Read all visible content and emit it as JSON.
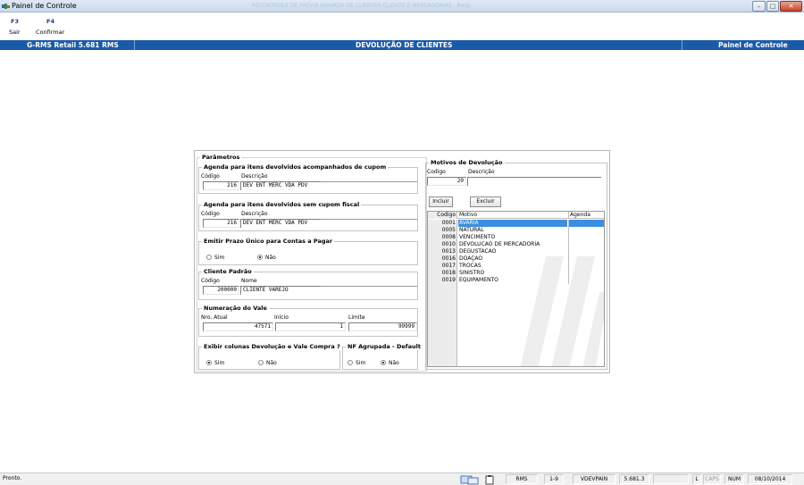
{
  "window": {
    "title": "Painel de Controle",
    "faded_title": "RECONTROLE DE PRÉVIA ENVIADA DE CLIENTES CLIENTE E MERCADORIAS - Rede",
    "controls": {
      "minimize": "–",
      "maximize": "□",
      "close": "✕"
    }
  },
  "toolbar": {
    "items": [
      {
        "key": "F3",
        "label": "Sair"
      },
      {
        "key": "F4",
        "label": "Confirmar"
      }
    ]
  },
  "header": {
    "left": "G-RMS Retail 5.681 RMS",
    "center": "DEVOLUÇÃO DE CLIENTES",
    "right": "Painel de Controle",
    "color": "#1a5ba8"
  },
  "params": {
    "title": "Parâmetros",
    "agenda_com_cupom": {
      "title": "Agenda para itens devolvidos acompanhados de cupom",
      "code_label": "Código",
      "desc_label": "Descrição",
      "code": "216",
      "desc": "DEV ENT MERC VDA PDV"
    },
    "agenda_sem_cupom": {
      "title": "Agenda para itens devolvidos sem cupom fiscal",
      "code_label": "Código",
      "desc_label": "Descrição",
      "code": "216",
      "desc": "DEV ENT MERC VDA PDV"
    },
    "prazo_unico": {
      "title": "Emitir Prazo Único para Contas a Pagar",
      "sim": "Sim",
      "nao": "Não",
      "selected": "Não"
    },
    "cliente_padrao": {
      "title": "Cliente Padrão",
      "code_label": "Código",
      "name_label": "Nome",
      "code": "200000",
      "name": "CLIENTE VAREJO"
    },
    "numeracao_vale": {
      "title": "Numeração do Vale",
      "atual_label": "Nro. Atual",
      "inicio_label": "Início",
      "limite_label": "Limite",
      "atual": "47571",
      "inicio": "1",
      "limite": "99999"
    },
    "exibir_colunas": {
      "title": "Exibir colunas Devolução e Vale Compra ?",
      "sim": "Sim",
      "nao": "Não",
      "selected": "Sim"
    },
    "nf_agrupada": {
      "title": "NF Agrupada - Default",
      "sim": "Sim",
      "nao": "Não",
      "selected": "Não"
    }
  },
  "motivos": {
    "title": "Motivos de Devolução",
    "code_label": "Codigo",
    "desc_label": "Descrição",
    "code": "20",
    "desc": "",
    "incluir": "Incluir",
    "excluir": "Excluir",
    "columns": [
      "Codigo",
      "Motivo",
      "Agenda"
    ],
    "rows": [
      {
        "code": "0001",
        "motivo": "AVARIA",
        "agenda": ""
      },
      {
        "code": "0005",
        "motivo": "NATURAL",
        "agenda": ""
      },
      {
        "code": "0008",
        "motivo": "VENCIMENTO",
        "agenda": ""
      },
      {
        "code": "0010",
        "motivo": "DEVOLUCAO DE MERCADORIA",
        "agenda": ""
      },
      {
        "code": "0013",
        "motivo": "DEGUSTACAO",
        "agenda": ""
      },
      {
        "code": "0016",
        "motivo": "DOAÇAO",
        "agenda": ""
      },
      {
        "code": "0017",
        "motivo": "TROCAS",
        "agenda": ""
      },
      {
        "code": "0018",
        "motivo": "SINISTRO",
        "agenda": ""
      },
      {
        "code": "0019",
        "motivo": "EQUIPAMENTO",
        "agenda": ""
      }
    ],
    "selected_index": 0
  },
  "status": {
    "message": "Pronto.",
    "cells": [
      "RMS",
      "1-9",
      "VDEVPAIN",
      "5.681.3",
      "",
      "L",
      "CAPS",
      "NUM",
      "08/10/2014"
    ],
    "muted": [
      "CAPS"
    ]
  }
}
